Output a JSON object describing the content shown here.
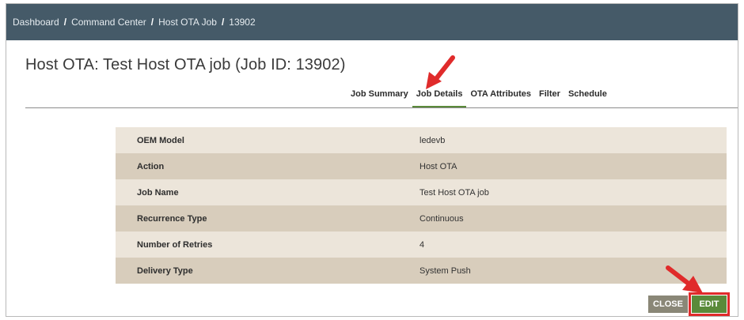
{
  "breadcrumb": {
    "items": [
      "Dashboard",
      "Command Center",
      "Host OTA Job",
      "13902"
    ],
    "separator": "/"
  },
  "page": {
    "title": "Host OTA: Test Host OTA job (Job ID: 13902)"
  },
  "tabs": [
    {
      "label": "Job Summary",
      "active": false
    },
    {
      "label": "Job Details",
      "active": true
    },
    {
      "label": "OTA Attributes",
      "active": false
    },
    {
      "label": "Filter",
      "active": false
    },
    {
      "label": "Schedule",
      "active": false
    }
  ],
  "details": [
    {
      "label": "OEM Model",
      "value": "ledevb"
    },
    {
      "label": "Action",
      "value": "Host OTA"
    },
    {
      "label": "Job Name",
      "value": "Test Host OTA job"
    },
    {
      "label": "Recurrence Type",
      "value": "Continuous"
    },
    {
      "label": "Number of Retries",
      "value": "4"
    },
    {
      "label": "Delivery Type",
      "value": "System Push"
    }
  ],
  "buttons": {
    "close_label": "CLOSE",
    "edit_label": "EDIT"
  },
  "colors": {
    "topbar": "#455a68",
    "accent_green": "#5a8a3a",
    "annotation_red": "#e02b2b"
  },
  "icons": {
    "annotation_arrow_1": "red-arrow-icon",
    "annotation_arrow_2": "red-arrow-icon"
  }
}
